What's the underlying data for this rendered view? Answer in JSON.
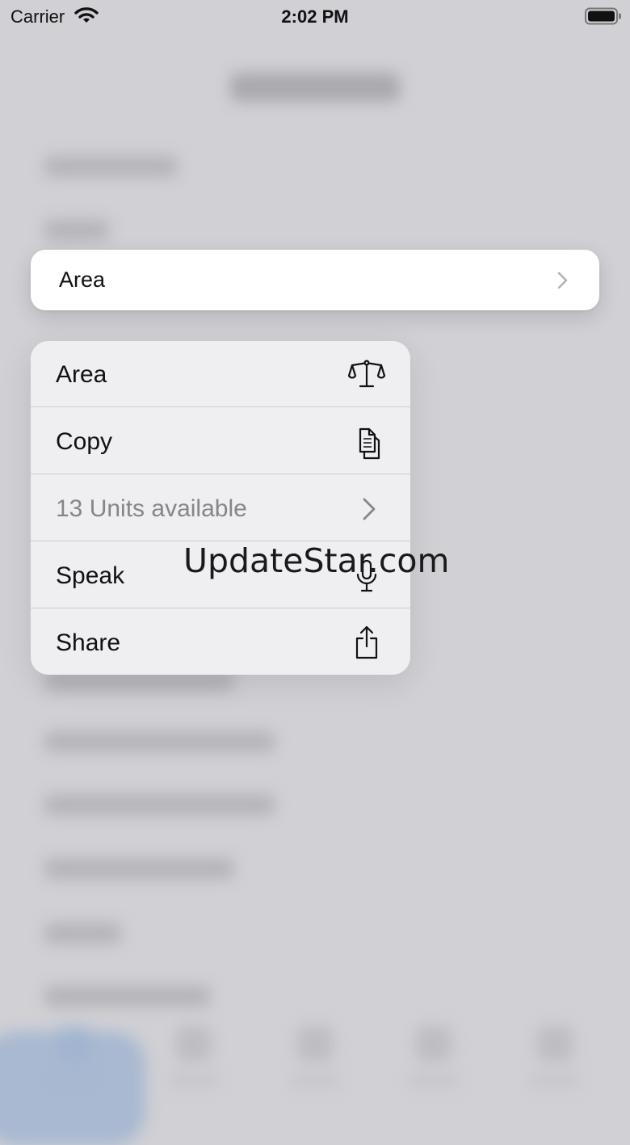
{
  "status_bar": {
    "carrier": "Carrier",
    "time": "2:02 PM"
  },
  "preview_row": {
    "label": "Area"
  },
  "context_menu": {
    "items": [
      {
        "label": "Area",
        "icon": "scale-icon",
        "disabled": false
      },
      {
        "label": "Copy",
        "icon": "copy-icon",
        "disabled": false
      },
      {
        "label": "13 Units available",
        "icon": "chevron-right-icon",
        "disabled": true
      },
      {
        "label": "Speak",
        "icon": "microphone-icon",
        "disabled": false
      },
      {
        "label": "Share",
        "icon": "share-icon",
        "disabled": false
      }
    ]
  },
  "watermark": "UpdateStar.com"
}
